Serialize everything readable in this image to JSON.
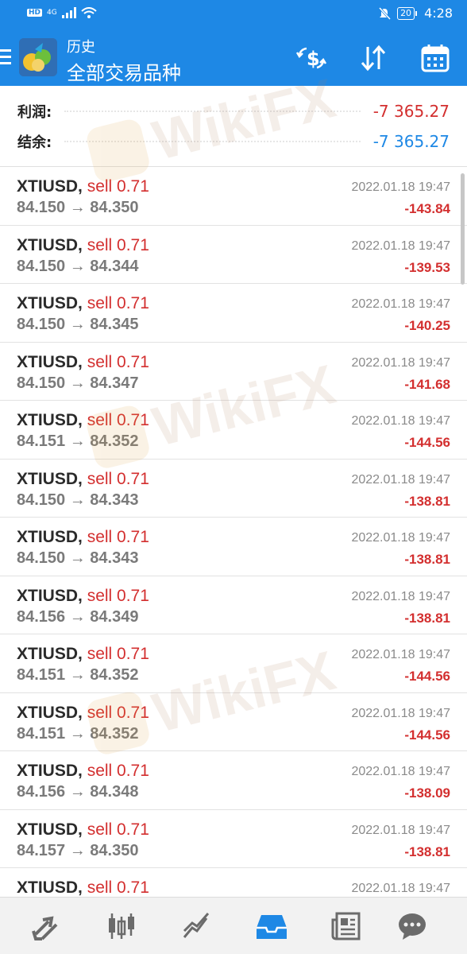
{
  "status_bar": {
    "left_labels": [
      "HD",
      "4G"
    ],
    "battery": "20",
    "time": "4:28"
  },
  "header": {
    "subtitle": "历史",
    "title": "全部交易品种",
    "icons": [
      "menu-icon",
      "app-logo",
      "currency-swap-icon",
      "sort-icon",
      "calendar-icon"
    ]
  },
  "summary": {
    "profit_label": "利润:",
    "profit_value": "-7 365.27",
    "balance_label": "结余:",
    "balance_value": "-7 365.27"
  },
  "trades": [
    {
      "symbol": "XTIUSD,",
      "side": "sell 0.71",
      "prices": "84.150 → 84.350",
      "time": "2022.01.18 19:47",
      "profit": "-143.84"
    },
    {
      "symbol": "XTIUSD,",
      "side": "sell 0.71",
      "prices": "84.150 → 84.344",
      "time": "2022.01.18 19:47",
      "profit": "-139.53"
    },
    {
      "symbol": "XTIUSD,",
      "side": "sell 0.71",
      "prices": "84.150 → 84.345",
      "time": "2022.01.18 19:47",
      "profit": "-140.25"
    },
    {
      "symbol": "XTIUSD,",
      "side": "sell 0.71",
      "prices": "84.150 → 84.347",
      "time": "2022.01.18 19:47",
      "profit": "-141.68"
    },
    {
      "symbol": "XTIUSD,",
      "side": "sell 0.71",
      "prices": "84.151 → 84.352",
      "time": "2022.01.18 19:47",
      "profit": "-144.56"
    },
    {
      "symbol": "XTIUSD,",
      "side": "sell 0.71",
      "prices": "84.150 → 84.343",
      "time": "2022.01.18 19:47",
      "profit": "-138.81"
    },
    {
      "symbol": "XTIUSD,",
      "side": "sell 0.71",
      "prices": "84.150 → 84.343",
      "time": "2022.01.18 19:47",
      "profit": "-138.81"
    },
    {
      "symbol": "XTIUSD,",
      "side": "sell 0.71",
      "prices": "84.156 → 84.349",
      "time": "2022.01.18 19:47",
      "profit": "-138.81"
    },
    {
      "symbol": "XTIUSD,",
      "side": "sell 0.71",
      "prices": "84.151 → 84.352",
      "time": "2022.01.18 19:47",
      "profit": "-144.56"
    },
    {
      "symbol": "XTIUSD,",
      "side": "sell 0.71",
      "prices": "84.151 → 84.352",
      "time": "2022.01.18 19:47",
      "profit": "-144.56"
    },
    {
      "symbol": "XTIUSD,",
      "side": "sell 0.71",
      "prices": "84.156 → 84.348",
      "time": "2022.01.18 19:47",
      "profit": "-138.09"
    },
    {
      "symbol": "XTIUSD,",
      "side": "sell 0.71",
      "prices": "84.157 → 84.350",
      "time": "2022.01.18 19:47",
      "profit": "-138.81"
    },
    {
      "symbol": "XTIUSD,",
      "side": "sell 0.71",
      "prices": "",
      "time": "2022.01.18 19:47",
      "profit": ""
    }
  ],
  "watermark": {
    "text": "WikiFX"
  },
  "bottom_nav": {
    "items": [
      "quotes-icon",
      "chart-icon",
      "trade-icon",
      "history-icon",
      "news-icon",
      "chat-icon"
    ],
    "active": "history-icon"
  },
  "colors": {
    "primary": "#1e88e5",
    "negative": "#d32f2f",
    "balance": "#1e88e5"
  }
}
